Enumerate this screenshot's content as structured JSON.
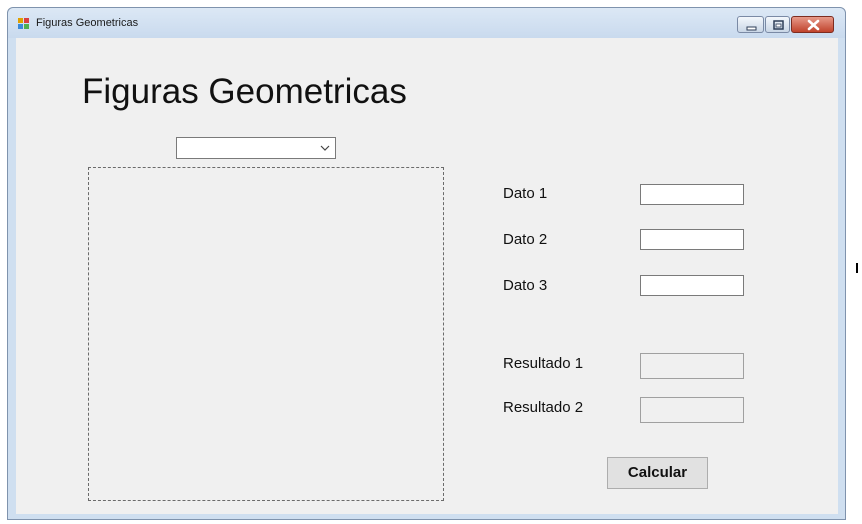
{
  "window": {
    "title": "Figuras Geometricas",
    "icon": "winforms-app-icon",
    "controls": {
      "minimize_icon": "minimize-icon",
      "maximize_icon": "maximize-icon",
      "close_icon": "close-icon"
    }
  },
  "form": {
    "heading": "Figuras Geometricas",
    "shape_select": {
      "selected": "",
      "icon": "chevron-down-icon"
    },
    "inputs": [
      {
        "label": "Dato 1",
        "value": ""
      },
      {
        "label": "Dato 2",
        "value": ""
      },
      {
        "label": "Dato 3",
        "value": ""
      }
    ],
    "results": [
      {
        "label": "Resultado 1",
        "value": ""
      },
      {
        "label": "Resultado 2",
        "value": ""
      }
    ],
    "calculate_label": "Calcular"
  },
  "colors": {
    "titlebar": "#cfdff0",
    "client_background": "#f0f0f0",
    "close_button": "#c0432c",
    "button_face": "#e1e1e1"
  }
}
